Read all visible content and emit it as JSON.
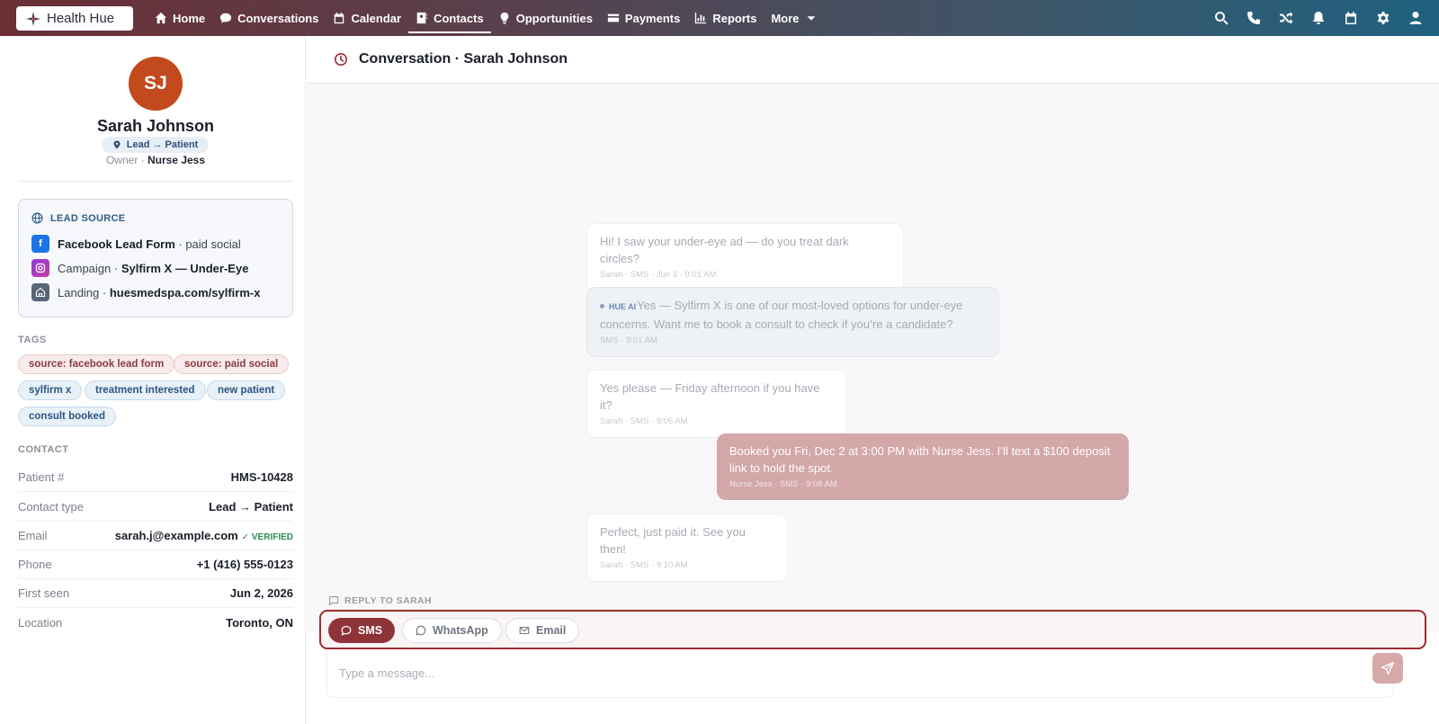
{
  "app": {
    "name": "Health Hue"
  },
  "nav": {
    "items": [
      {
        "label": "Home",
        "icon": "home-icon"
      },
      {
        "label": "Conversations",
        "icon": "chat-icon"
      },
      {
        "label": "Calendar",
        "icon": "calendar-icon"
      },
      {
        "label": "Contacts",
        "icon": "contacts-icon",
        "active": true
      },
      {
        "label": "Opportunities",
        "icon": "lightbulb-icon"
      },
      {
        "label": "Payments",
        "icon": "credit-card-icon"
      },
      {
        "label": "Reports",
        "icon": "bar-chart-icon"
      },
      {
        "label": "More",
        "icon": "caret-down-icon"
      }
    ],
    "right_icons": [
      "search-icon",
      "phone-icon",
      "shuffle-icon",
      "bell-icon",
      "calendar-icon",
      "gear-icon",
      "user-icon"
    ]
  },
  "contact": {
    "initials": "SJ",
    "name": "Sarah Johnson",
    "status": "Lead → Patient",
    "owner_label": "Owner",
    "owner": "Nurse Jess",
    "avatar_color": "#c24a1c"
  },
  "lead_source": {
    "title": "LEAD SOURCE",
    "rows": [
      {
        "icon": "facebook-icon",
        "strong": "Facebook Lead Form",
        "suffix": "· paid social"
      },
      {
        "icon": "instagram-icon",
        "prefix": "Campaign ·",
        "strong": "Sylfirm X — Under-Eye"
      },
      {
        "icon": "landing-page-icon",
        "prefix": "Landing ·",
        "strong": "huesmedspa.com/sylfirm-x"
      }
    ]
  },
  "tags": {
    "title": "TAGS",
    "items": [
      {
        "label": "source: facebook lead form",
        "tone": "red"
      },
      {
        "label": "source: paid social",
        "tone": "red"
      },
      {
        "label": "sylfirm x",
        "tone": "blue"
      },
      {
        "label": "treatment interested",
        "tone": "blue"
      },
      {
        "label": "new patient",
        "tone": "blue"
      },
      {
        "label": "consult booked",
        "tone": "blue"
      }
    ]
  },
  "contact_info": {
    "title": "CONTACT",
    "rows": [
      {
        "label": "Patient #",
        "value": "HMS-10428"
      },
      {
        "label": "Contact type",
        "value": "Lead → Patient"
      },
      {
        "label": "Email",
        "value": "sarah.j@example.com",
        "badge": "✓ VERIFIED"
      },
      {
        "label": "Phone",
        "value": "+1 (416) 555-0123"
      },
      {
        "label": "First seen",
        "value": "Jun 2, 2026"
      },
      {
        "label": "Location",
        "value": "Toronto, ON"
      }
    ]
  },
  "conversation": {
    "title": "Conversation · Sarah Johnson",
    "messages": [
      {
        "direction": "in",
        "text": "Hi! I saw your under-eye ad — do you treat dark circles?",
        "meta": "Sarah · SMS · Jun 3 · 9:01 AM"
      },
      {
        "direction": "ai",
        "ai_label": "HUE AI",
        "text": "Yes — Sylfirm X is one of our most-loved options for under-eye concerns. Want me to book a consult to check if you’re a candidate?",
        "meta": "SMS · 9:01 AM"
      },
      {
        "direction": "in",
        "text": "Yes please — Friday afternoon if you have it?",
        "meta": "Sarah · SMS · 9:05 AM"
      },
      {
        "direction": "out",
        "text": "Booked you Fri, Dec 2 at 3:00 PM with Nurse Jess. I’ll text a $100 deposit link to hold the spot.",
        "meta": "Nurse Jess · SMS · 9:08 AM"
      },
      {
        "direction": "in",
        "text": "Perfect, just paid it. See you then!",
        "meta": "Sarah · SMS · 9:10 AM"
      }
    ]
  },
  "reply": {
    "label": "REPLY TO SARAH",
    "channels": [
      {
        "label": "SMS",
        "active": true
      },
      {
        "label": "WhatsApp",
        "active": false
      },
      {
        "label": "Email",
        "active": false
      }
    ],
    "placeholder": "Type a message..."
  }
}
